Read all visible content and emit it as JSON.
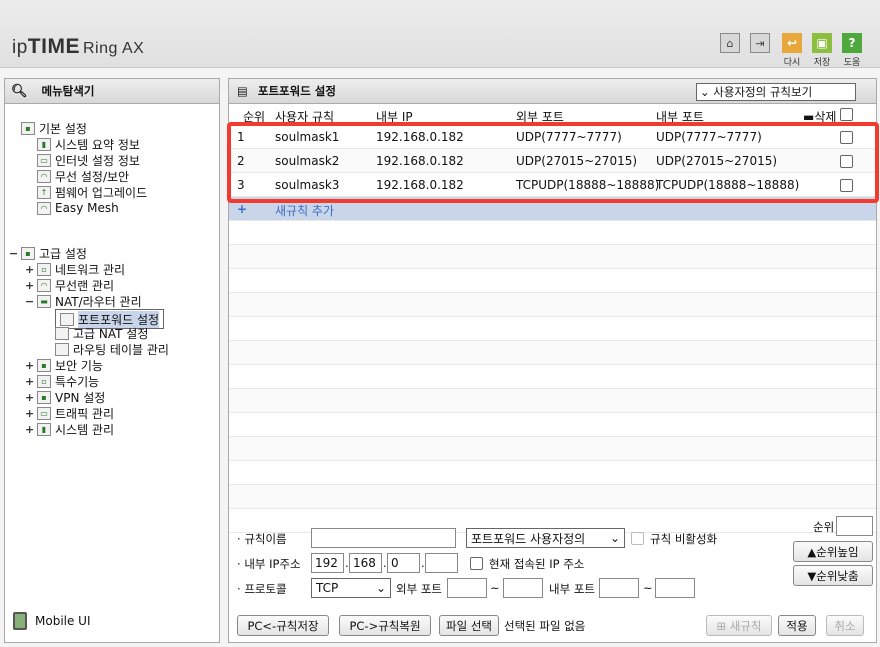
{
  "app": {
    "logo_ip": "ip",
    "logo_time": "TIME",
    "logo_model": "Ring AX"
  },
  "header_buttons": [
    {
      "label": "다시",
      "color": "#e7a73a"
    },
    {
      "label": "저장",
      "color": "#8cbf3f"
    },
    {
      "label": "도움",
      "color": "#4fa83d"
    }
  ],
  "sidebar": {
    "title": "메뉴탐색기",
    "basic": {
      "label": "기본 설정",
      "items": [
        "시스템 요약 정보",
        "인터넷 설정 정보",
        "무선 설정/보안",
        "펌웨어 업그레이드",
        "Easy Mesh"
      ]
    },
    "advanced": {
      "label": "고급 설정",
      "items": [
        "네트워크 관리",
        "무선랜 관리",
        "NAT/라우터 관리"
      ],
      "nat_children": [
        "포트포워드 설정",
        "고급 NAT 설정",
        "라우팅 테이블 관리"
      ],
      "more": [
        "보안 기능",
        "특수기능",
        "VPN 설정",
        "트래픽 관리",
        "시스템 관리"
      ]
    },
    "mobile": "Mobile UI"
  },
  "main": {
    "title": "포트포워드 설정",
    "view_select": "사용자정의 규칙보기",
    "columns": [
      "순위",
      "사용자 규칙",
      "내부 IP",
      "외부 포트",
      "내부 포트",
      "삭제"
    ],
    "rows": [
      {
        "rank": "1",
        "name": "soulmask1",
        "ip": "192.168.0.182",
        "ext": "UDP(7777~7777)",
        "int": "UDP(7777~7777)"
      },
      {
        "rank": "2",
        "name": "soulmask2",
        "ip": "192.168.0.182",
        "ext": "UDP(27015~27015)",
        "int": "UDP(27015~27015)"
      },
      {
        "rank": "3",
        "name": "soulmask3",
        "ip": "192.168.0.182",
        "ext": "TCPUDP(18888~18888)",
        "int": "TCPUDP(18888~18888)"
      }
    ],
    "add_icon": "+",
    "add_rule": "새규칙 추가"
  },
  "form": {
    "rule_name_label": "규칙이름",
    "rule_type": "포트포워드 사용자정의",
    "disable_label": "규칙 비활성화",
    "ip_label": "내부 IP주소",
    "ip": [
      "192",
      "168",
      "0",
      ""
    ],
    "current_ip_label": "현재 접속된 IP 주소",
    "proto_label": "프로토콜",
    "proto": "TCP",
    "ext_port_label": "외부 포트",
    "int_port_label": "내부 포트",
    "tilde": "~",
    "rank_label": "순위",
    "up_btn": "순위높임",
    "down_btn": "순위낮춤",
    "save_pc": "PC<-규칙저장",
    "restore_pc": "PC->규칙복원",
    "file_select": "파일 선택",
    "no_file": "선택된 파일 없음",
    "new_rule": "새규칙",
    "apply": "적용",
    "cancel": "취소"
  }
}
